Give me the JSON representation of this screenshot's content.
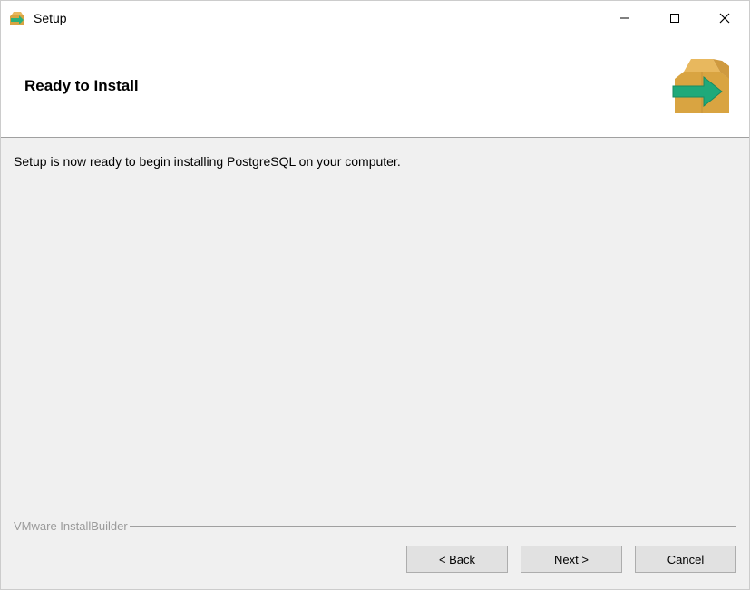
{
  "window": {
    "title": "Setup"
  },
  "header": {
    "title": "Ready to Install"
  },
  "content": {
    "message": "Setup is now ready to begin installing PostgreSQL on your computer."
  },
  "footer": {
    "brand": "VMware InstallBuilder",
    "back_label": "< Back",
    "next_label": "Next >",
    "cancel_label": "Cancel"
  }
}
